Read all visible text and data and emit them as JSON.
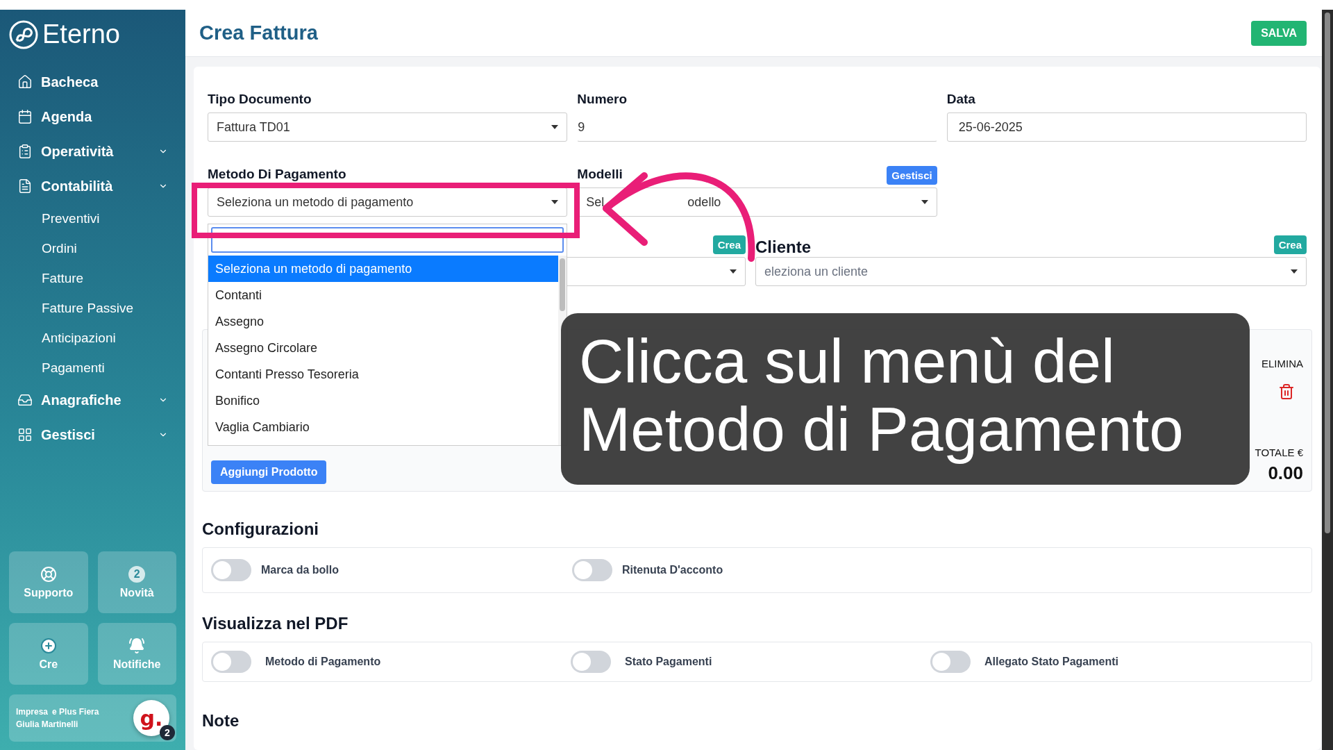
{
  "sidebar": {
    "brand": "Eterno",
    "items": [
      {
        "label": "Bacheca",
        "kind": "link"
      },
      {
        "label": "Agenda",
        "kind": "link"
      },
      {
        "label": "Operatività",
        "kind": "group"
      },
      {
        "label": "Contabilità",
        "kind": "group",
        "children": [
          {
            "label": "Preventivi"
          },
          {
            "label": "Ordini"
          },
          {
            "label": "Fatture"
          },
          {
            "label": "Fatture Passive"
          },
          {
            "label": "Anticipazioni"
          },
          {
            "label": "Pagamenti"
          }
        ]
      },
      {
        "label": "Anagrafiche",
        "kind": "group"
      },
      {
        "label": "Gestisci",
        "kind": "group"
      }
    ],
    "tiles": [
      {
        "label": "Supporto"
      },
      {
        "label": "Novità"
      },
      {
        "label": "Cre"
      },
      {
        "label": "Notifiche"
      }
    ],
    "news_count": "2",
    "account": {
      "company_start": "Impresa",
      "company_end": "e Plus Fiera",
      "user": "Giulia Martinelli"
    },
    "avatar": {
      "letter": "g.",
      "badge": "2"
    }
  },
  "header": {
    "title": "Crea Fattura",
    "save": "SALVA"
  },
  "form": {
    "tipo_documento": {
      "label": "Tipo Documento",
      "value": "Fattura TD01"
    },
    "numero": {
      "label": "Numero",
      "value": "9"
    },
    "data": {
      "label": "Data",
      "value": "25-06-2025"
    },
    "metodo_pagamento": {
      "label": "Metodo Di Pagamento",
      "placeholder": "Seleziona un metodo di pagamento",
      "options": [
        {
          "label": "Seleziona un metodo di pagamento",
          "selected": true
        },
        {
          "label": "Contanti",
          "selected": false
        },
        {
          "label": "Assegno",
          "selected": false
        },
        {
          "label": "Assegno Circolare",
          "selected": false
        },
        {
          "label": "Contanti Presso Tesoreria",
          "selected": false
        },
        {
          "label": "Bonifico",
          "selected": false
        },
        {
          "label": "Vaglia Cambiario",
          "selected": false
        }
      ]
    },
    "modelli": {
      "label": "Modelli",
      "action": "Gestisci",
      "placeholder_start": "Sel",
      "placeholder_end": "odello"
    },
    "column_3": {
      "action": "Crea"
    },
    "cliente": {
      "label": "Cliente",
      "action": "Crea",
      "placeholder": "eleziona un cliente"
    }
  },
  "products": {
    "columns": [
      "ELIMINA"
    ],
    "totals": {
      "label": "TOTALE €",
      "value": "0.00"
    },
    "add": "Aggiungi Prodotto"
  },
  "configurazioni": {
    "title": "Configurazioni",
    "toggles": [
      {
        "label": "Marca da bollo",
        "on": false
      },
      {
        "label": "Ritenuta D'acconto",
        "on": false
      }
    ]
  },
  "pdf": {
    "title": "Visualizza nel PDF",
    "toggles": [
      {
        "label": "Metodo di Pagamento",
        "on": false
      },
      {
        "label": "Stato Pagamenti",
        "on": false
      },
      {
        "label": "Allegato Stato Pagamenti",
        "on": false
      }
    ]
  },
  "note": {
    "title": "Note"
  },
  "tutorial": {
    "caption_lines": [
      "Clicca sul menù del",
      "Metodo di Pagamento"
    ]
  }
}
